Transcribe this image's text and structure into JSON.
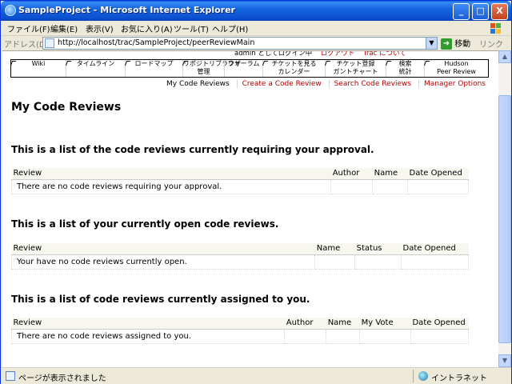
{
  "window": {
    "title": "SampleProject - Microsoft Internet Explorer",
    "minimize_label": "_",
    "maximize_label": "□",
    "close_label": "X"
  },
  "menu": [
    "ファイル(F)",
    "編集(E)",
    "表示(V)",
    "お気に入り(A)",
    "ツール(T)",
    "ヘルプ(H)"
  ],
  "address": {
    "label": "アドレス(D)",
    "url": "http://localhost/trac/SampleProject/peerReviewMain",
    "go_label": "移動",
    "links_label": "リンク"
  },
  "trac": {
    "meta_line_1": "admin としてログイン中",
    "meta_line_2": "ログアウト",
    "meta_line_3": "Trac について",
    "nav": [
      {
        "line1": "Wiki",
        "line2": ""
      },
      {
        "line1": "タイムライン",
        "line2": ""
      },
      {
        "line1": "ロードマップ",
        "line2": ""
      },
      {
        "line1": "リポジトリブラウザ",
        "line2": "管理"
      },
      {
        "line1": "",
        "line2": "フォーラム"
      },
      {
        "line1": "チケットを見る",
        "line2": "カレンダー"
      },
      {
        "line1": "チケット登録",
        "line2": "ガントチャート"
      },
      {
        "line1": "検索",
        "line2": "統計"
      },
      {
        "line1": "Hudson",
        "line2": "Peer Review"
      }
    ],
    "ctxnav": [
      "My Code Reviews",
      "Create a Code Review",
      "Search Code Reviews",
      "Manager Options"
    ],
    "page_title": "My Code Reviews",
    "sections": [
      {
        "heading": "This is a list of the code reviews currently requiring your approval.",
        "columns": [
          "Review",
          "Author",
          "Name",
          "Date Opened"
        ],
        "empty_message": "There are no code reviews requiring your approval."
      },
      {
        "heading": "This is a list of your currently open code reviews.",
        "columns": [
          "Review",
          "Name",
          "Status",
          "Date Opened"
        ],
        "empty_message": "Your have no code reviews currently open."
      },
      {
        "heading": "This is a list of code reviews currently assigned to you.",
        "columns": [
          "Review",
          "Author",
          "Name",
          "My Vote",
          "Date Opened"
        ],
        "empty_message": "There are no code reviews assigned to you."
      }
    ]
  },
  "status": {
    "message": "ページが表示されました",
    "zone": "イントラネット"
  }
}
